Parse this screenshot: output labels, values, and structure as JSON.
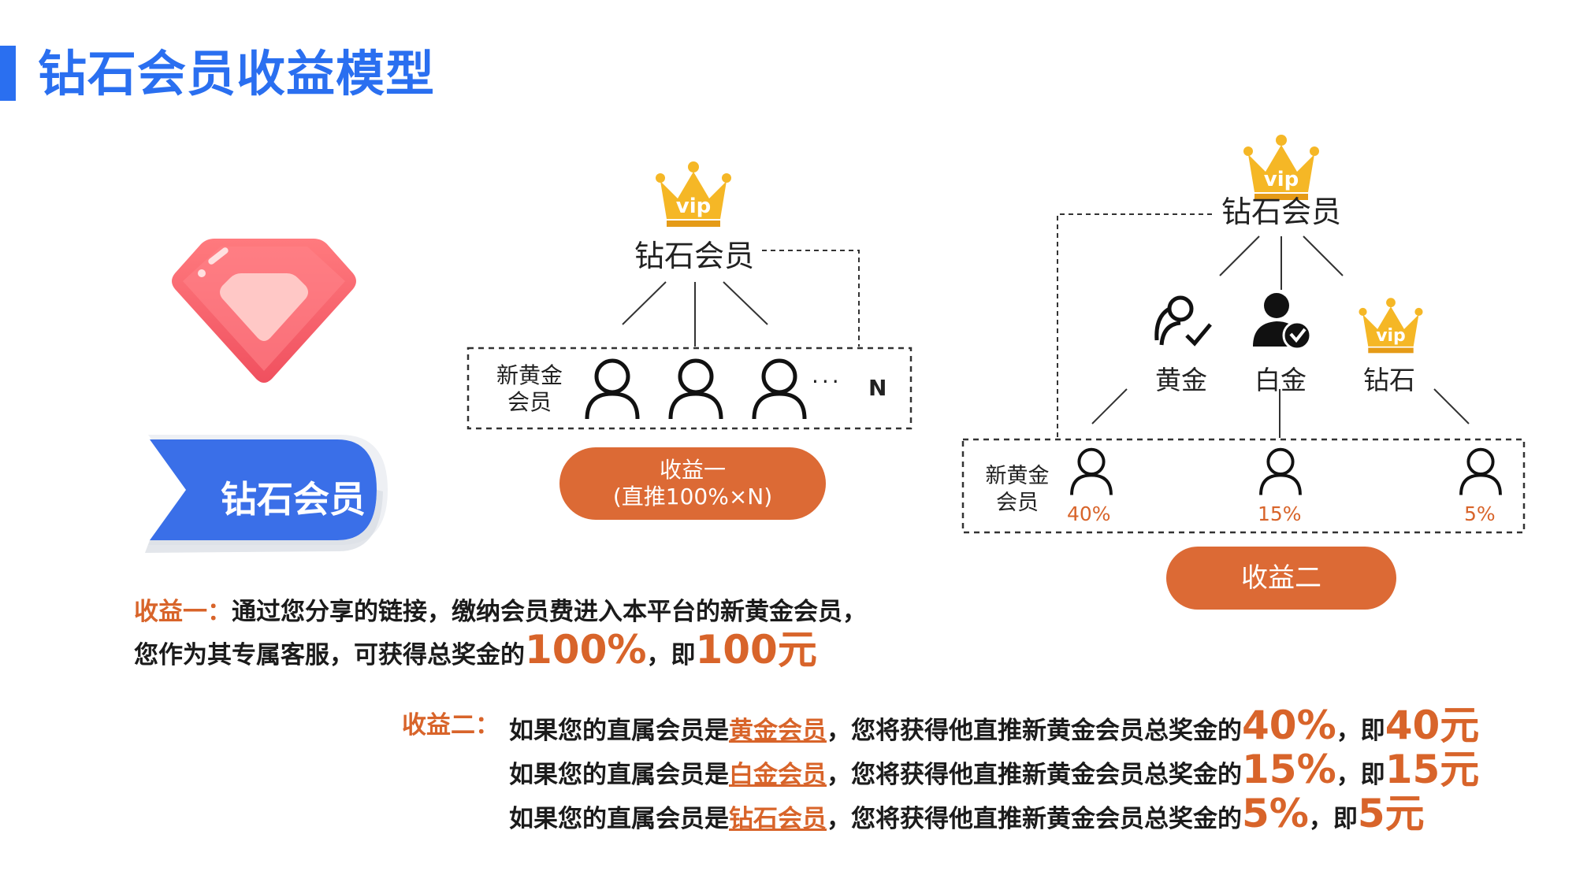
{
  "title": "钻石会员收益模型",
  "badge_label": "钻石会员",
  "colors": {
    "accent_blue": "#2a6ff0",
    "orange": "#dc6a35",
    "gem_red": "#f0505f"
  },
  "icons": [
    "ruby-gem-icon",
    "vip-crown-icon",
    "user-outline-icon",
    "user-check-icon",
    "verified-user-icon"
  ],
  "diagram1": {
    "top_label": "钻石会员",
    "crown_text": "vip",
    "group_label": "新黄金\n会员",
    "ellipsis": "···",
    "n_label": "N",
    "pill_line1": "收益一",
    "pill_line2": "(直推100%×N)"
  },
  "diagram2": {
    "top_label": "钻石会员",
    "crown_text": "vip",
    "members": [
      {
        "label": "黄金"
      },
      {
        "label": "白金"
      },
      {
        "label": "钻石"
      }
    ],
    "group_label": "新黄金\n会员",
    "percents": [
      "40%",
      "15%",
      "5%"
    ],
    "pill": "收益二"
  },
  "income1": {
    "head": "收益一：",
    "line1": "通过您分享的链接，缴纳会员费进入本平台的新黄金会员，",
    "line2_pre": "您作为其专属客服，可获得总奖金的",
    "pct": "100%",
    "mid": "，即",
    "amount": "100元"
  },
  "income2": {
    "head": "收益二：",
    "rows": [
      {
        "pre": "如果您的直属会员是",
        "member": "黄金会员",
        "post": "，您将获得他直推新黄金会员总奖金的",
        "pct": "40%",
        "mid": "，即",
        "amount": "40元"
      },
      {
        "pre": "如果您的直属会员是",
        "member": "白金会员",
        "post": "，您将获得他直推新黄金会员总奖金的",
        "pct": "15%",
        "mid": "，即",
        "amount": "15元"
      },
      {
        "pre": "如果您的直属会员是",
        "member": "钻石会员",
        "post": "，您将获得他直推新黄金会员总奖金的",
        "pct": "5%",
        "mid": "，即",
        "amount": "5元"
      }
    ]
  }
}
